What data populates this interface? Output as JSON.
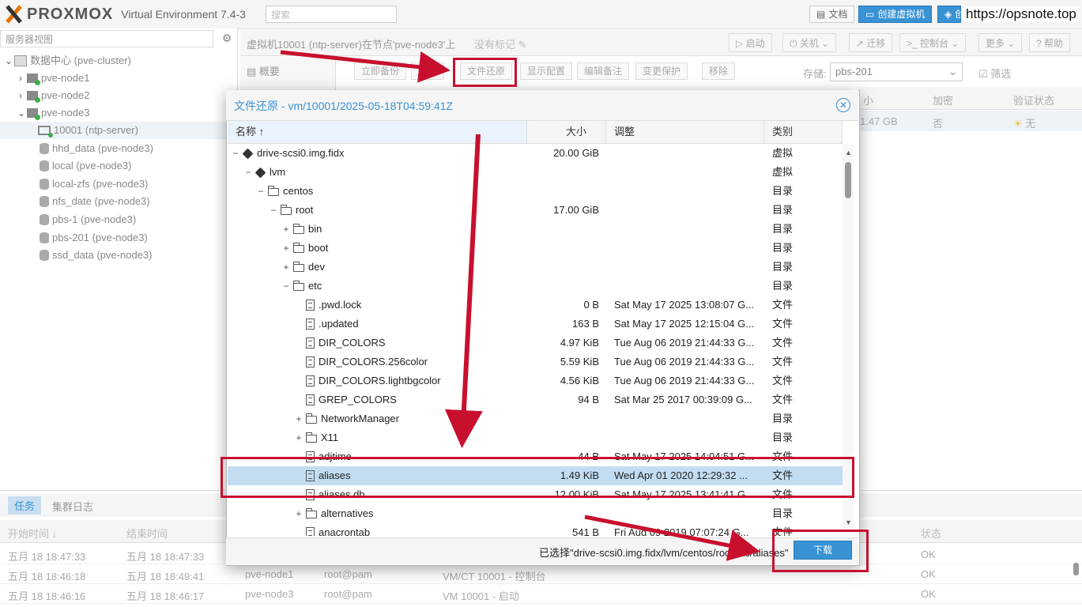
{
  "app": {
    "brand": "PROXMOX",
    "product": "Virtual Environment 7.4-3",
    "search_placeholder": "搜索",
    "top_buttons": {
      "docs": "文档",
      "create_vm": "创建虚拟机",
      "create_ct": "创"
    },
    "watermark": "https://opsnote.top"
  },
  "sidebar": {
    "view": "服务器视图",
    "items": [
      {
        "label": "数据中心 (pve-cluster)"
      },
      {
        "label": "pve-node1"
      },
      {
        "label": "pve-node2"
      },
      {
        "label": "pve-node3"
      },
      {
        "label": "10001 (ntp-server)"
      },
      {
        "label": "hhd_data (pve-node3)"
      },
      {
        "label": "local (pve-node3)"
      },
      {
        "label": "local-zfs (pve-node3)"
      },
      {
        "label": "nfs_date (pve-node3)"
      },
      {
        "label": "pbs-1 (pve-node3)"
      },
      {
        "label": "pbs-201 (pve-node3)"
      },
      {
        "label": "ssd_data (pve-node3)"
      }
    ]
  },
  "header": {
    "vm_title": "虚拟机10001 (ntp-server)在节点'pve-node3'上",
    "no_tag": "没有标记",
    "buttons": {
      "start": "启动",
      "shutdown": "关机",
      "migrate": "迁移",
      "console": "控制台",
      "more": "更多",
      "help": "帮助"
    }
  },
  "nav": {
    "overview": "概要"
  },
  "toolbar": {
    "backup_now": "立即备份",
    "restore": "还原",
    "file_restore": "文件还原",
    "show_config": "显示配置",
    "edit_notes": "编辑备注",
    "change_protection": "变更保护",
    "remove": "移除",
    "storage_label": "存储:",
    "storage_value": "pbs-201",
    "filter": "筛选"
  },
  "bg_grid": {
    "col_encrypt": "加密",
    "col_verify": "验证状态",
    "col_size_partial": "小",
    "size": "1.47 GB",
    "encrypt": "否",
    "verify": "无"
  },
  "tasks": {
    "tab_tasks": "任务",
    "tab_cluster": "集群日志",
    "headers": {
      "start": "开始时间 ↓",
      "end": "结束时间",
      "status": "状态"
    },
    "rows": [
      {
        "start": "五月 18 18:47:33",
        "end": "五月 18 18:47:33",
        "node": "",
        "user": "",
        "desc": "",
        "status": "OK"
      },
      {
        "start": "五月 18 18:46:18",
        "end": "五月 18 18:49:41",
        "node": "pve-node1",
        "user": "root@pam",
        "desc": "VM/CT 10001 - 控制台",
        "status": "OK"
      },
      {
        "start": "五月 18 18:46:16",
        "end": "五月 18 18:46:17",
        "node": "pve-node3",
        "user": "root@pam",
        "desc": "VM 10001 - 启动",
        "status": "OK"
      }
    ]
  },
  "dialog": {
    "title": "文件还原 - vm/10001/2025-05-18T04:59:41Z",
    "columns": {
      "name": "名称 ↑",
      "size": "大小",
      "modified": "调整",
      "type": "类别"
    },
    "rows": [
      {
        "indent": 0,
        "icon": "cube",
        "exp": "−",
        "name": "drive-scsi0.img.fidx",
        "size": "20.00 GiB",
        "mod": "",
        "type": "虚拟"
      },
      {
        "indent": 1,
        "icon": "cube",
        "exp": "−",
        "name": "lvm",
        "size": "",
        "mod": "",
        "type": "虚拟"
      },
      {
        "indent": 2,
        "icon": "folder",
        "exp": "−",
        "name": "centos",
        "size": "",
        "mod": "",
        "type": "目录"
      },
      {
        "indent": 3,
        "icon": "folder",
        "exp": "−",
        "name": "root",
        "size": "17.00 GiB",
        "mod": "",
        "type": "目录"
      },
      {
        "indent": 4,
        "icon": "folder",
        "exp": "+",
        "name": "bin",
        "size": "",
        "mod": "",
        "type": "目录"
      },
      {
        "indent": 4,
        "icon": "folder",
        "exp": "+",
        "name": "boot",
        "size": "",
        "mod": "",
        "type": "目录"
      },
      {
        "indent": 4,
        "icon": "folder",
        "exp": "+",
        "name": "dev",
        "size": "",
        "mod": "",
        "type": "目录"
      },
      {
        "indent": 4,
        "icon": "folder",
        "exp": "−",
        "name": "etc",
        "size": "",
        "mod": "",
        "type": "目录"
      },
      {
        "indent": 5,
        "icon": "file",
        "exp": "",
        "name": ".pwd.lock",
        "size": "0 B",
        "mod": "Sat May 17 2025 13:08:07 G...",
        "type": "文件"
      },
      {
        "indent": 5,
        "icon": "file",
        "exp": "",
        "name": ".updated",
        "size": "163 B",
        "mod": "Sat May 17 2025 12:15:04 G...",
        "type": "文件"
      },
      {
        "indent": 5,
        "icon": "file",
        "exp": "",
        "name": "DIR_COLORS",
        "size": "4.97 KiB",
        "mod": "Tue Aug 06 2019 21:44:33 G...",
        "type": "文件"
      },
      {
        "indent": 5,
        "icon": "file",
        "exp": "",
        "name": "DIR_COLORS.256color",
        "size": "5.59 KiB",
        "mod": "Tue Aug 06 2019 21:44:33 G...",
        "type": "文件"
      },
      {
        "indent": 5,
        "icon": "file",
        "exp": "",
        "name": "DIR_COLORS.lightbgcolor",
        "size": "4.56 KiB",
        "mod": "Tue Aug 06 2019 21:44:33 G...",
        "type": "文件"
      },
      {
        "indent": 5,
        "icon": "file",
        "exp": "",
        "name": "GREP_COLORS",
        "size": "94 B",
        "mod": "Sat Mar 25 2017 00:39:09 G...",
        "type": "文件"
      },
      {
        "indent": 5,
        "icon": "folder",
        "exp": "+",
        "name": "NetworkManager",
        "size": "",
        "mod": "",
        "type": "目录"
      },
      {
        "indent": 5,
        "icon": "folder",
        "exp": "+",
        "name": "X11",
        "size": "",
        "mod": "",
        "type": "目录"
      },
      {
        "indent": 5,
        "icon": "file",
        "exp": "",
        "name": "adjtime",
        "size": "44 B",
        "mod": "Sat May 17 2025 14:04:51 G...",
        "type": "文件"
      },
      {
        "indent": 5,
        "icon": "file",
        "exp": "",
        "name": "aliases",
        "size": "1.49 KiB",
        "mod": "Wed Apr 01 2020 12:29:32 ...",
        "type": "文件",
        "selected": true
      },
      {
        "indent": 5,
        "icon": "file",
        "exp": "",
        "name": "aliases.db",
        "size": "12.00 KiB",
        "mod": "Sat May 17 2025 13:41:41 G...",
        "type": "文件"
      },
      {
        "indent": 5,
        "icon": "folder",
        "exp": "+",
        "name": "alternatives",
        "size": "",
        "mod": "",
        "type": "目录"
      },
      {
        "indent": 5,
        "icon": "file",
        "exp": "",
        "name": "anacrontab",
        "size": "541 B",
        "mod": "Fri Aug 09 2019 07:07:24 G...",
        "type": "文件"
      }
    ],
    "selected_text": "已选择\"drive-scsi0.img.fidx/lvm/centos/root/etc/aliases\"",
    "download": "下载"
  },
  "colors": {
    "accent": "#3892d4",
    "annotation": "#c8102e",
    "selection": "#c2ddf2"
  }
}
